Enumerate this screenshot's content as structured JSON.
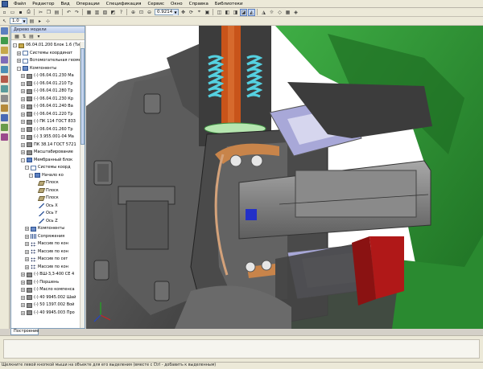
{
  "menu": [
    "Файл",
    "Редактор",
    "Вид",
    "Операции",
    "Спецификация",
    "Сервис",
    "Окно",
    "Справка",
    "Библиотеки"
  ],
  "toolbar": {
    "zoom_value": "0.9214",
    "scale_value": "1.0"
  },
  "tree": {
    "title": "Дерево модели",
    "tab_label": "Построение",
    "rows": [
      {
        "label": "06.04.01.200 Блок 1.6 (Тип-2)",
        "level": 0,
        "exp": "-",
        "icon": "assy"
      },
      {
        "label": "Системы координат",
        "level": 1,
        "exp": "+",
        "icon": "sys"
      },
      {
        "label": "Вспомогательная геометрия",
        "level": 1,
        "exp": "+",
        "icon": "sys"
      },
      {
        "label": "Компоненты",
        "level": 1,
        "exp": "-",
        "icon": "comp"
      },
      {
        "label": "(-) 06.04.01.230 Ма",
        "level": 2,
        "exp": "+",
        "icon": "part"
      },
      {
        "label": "(-) 06.04.01.210 Тр",
        "level": 2,
        "exp": "+",
        "icon": "part"
      },
      {
        "label": "(-) 06.04.01.280 Тр",
        "level": 2,
        "exp": "+",
        "icon": "part"
      },
      {
        "label": "(-) 06.04.01.230 Кр",
        "level": 2,
        "exp": "+",
        "icon": "part"
      },
      {
        "label": "(-) 06.04.01.240 Ва",
        "level": 2,
        "exp": "+",
        "icon": "part"
      },
      {
        "label": "(-) 06.04.01.220 Тр",
        "level": 2,
        "exp": "+",
        "icon": "part"
      },
      {
        "label": "(-) ПК 114 ГОСТ 833",
        "level": 2,
        "exp": "+",
        "icon": "part"
      },
      {
        "label": "(-) 06.04.01.260 Тр",
        "level": 2,
        "exp": "+",
        "icon": "part"
      },
      {
        "label": "(-) 3.955.001-04 Ма",
        "level": 2,
        "exp": "+",
        "icon": "part"
      },
      {
        "label": "ПК 38.14 ГОСТ 5721",
        "level": 2,
        "exp": "+",
        "icon": "part"
      },
      {
        "label": "Масштабирование",
        "level": 2,
        "exp": "+",
        "icon": "part"
      },
      {
        "label": "Мембранный блок",
        "level": 2,
        "exp": "-",
        "icon": "sel"
      },
      {
        "label": "Системы коорд",
        "level": 3,
        "exp": "-",
        "icon": "sys"
      },
      {
        "label": "Начало ко",
        "level": 4,
        "exp": "-",
        "icon": "sel"
      },
      {
        "label": "Плоск",
        "level": 5,
        "exp": "",
        "icon": "plane"
      },
      {
        "label": "Плоск",
        "level": 5,
        "exp": "",
        "icon": "plane"
      },
      {
        "label": "Плоск",
        "level": 5,
        "exp": "",
        "icon": "plane"
      },
      {
        "label": "Ось Х",
        "level": 5,
        "exp": "",
        "icon": "axis"
      },
      {
        "label": "Ось Y",
        "level": 5,
        "exp": "",
        "icon": "axis"
      },
      {
        "label": "Ось Z",
        "level": 5,
        "exp": "",
        "icon": "axis"
      },
      {
        "label": "Компоненты",
        "level": 3,
        "exp": "+",
        "icon": "comp"
      },
      {
        "label": "Сопряжения",
        "level": 3,
        "exp": "+",
        "icon": "spring"
      },
      {
        "label": "Массив по кон",
        "level": 3,
        "exp": "+",
        "icon": "mass"
      },
      {
        "label": "Массив по кон",
        "level": 3,
        "exp": "+",
        "icon": "mass"
      },
      {
        "label": "Массив по сет",
        "level": 3,
        "exp": "+",
        "icon": "mass"
      },
      {
        "label": "Массив по кон",
        "level": 3,
        "exp": "+",
        "icon": "mass"
      },
      {
        "label": "(-) ВШ-3,3-400 СЕ 4",
        "level": 2,
        "exp": "+",
        "icon": "part"
      },
      {
        "label": "(-) Поршень",
        "level": 2,
        "exp": "+",
        "icon": "part"
      },
      {
        "label": "(-) Масло компенса",
        "level": 2,
        "exp": "+",
        "icon": "part"
      },
      {
        "label": "(-) 40 9945.002 Шай",
        "level": 2,
        "exp": "+",
        "icon": "part"
      },
      {
        "label": "(-) 50 1397.002 Вой",
        "level": 2,
        "exp": "+",
        "icon": "part"
      },
      {
        "label": "(-) 40 9945.003 Про",
        "level": 2,
        "exp": "+",
        "icon": "part"
      }
    ]
  },
  "status": {
    "text": "Щелкните левой кнопкой мыши на объекте для его выделения (вместе с Ctrl - добавить к выделенным)"
  },
  "colors": {
    "background_green": "#2e8a34",
    "part_gray": "#4a4a4a",
    "shaft_gray": "#7a7a7a",
    "bearing_lavender": "#a8a8d8",
    "spring_cyan": "#55d0e0",
    "rod_orange": "#c8541a",
    "copper": "#c8844a",
    "red_part": "#b01818"
  }
}
